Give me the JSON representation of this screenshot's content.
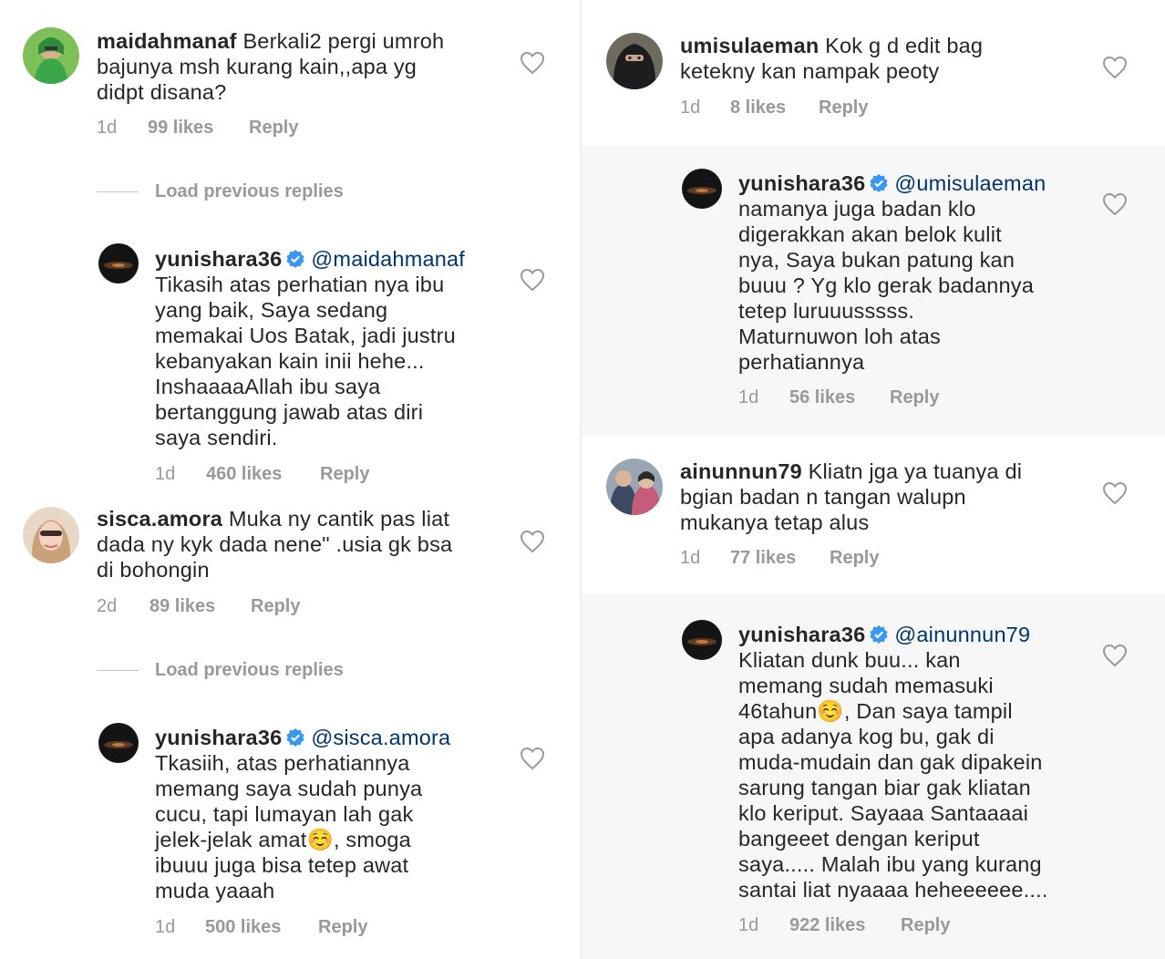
{
  "left": {
    "comments": [
      {
        "username": "maidahmanaf",
        "text": "Berkali2 pergi umroh\nbajunya msh kurang kain,,apa yg\ndidpt disana?",
        "time": "1d",
        "likes": "99 likes",
        "reply": "Reply"
      },
      {
        "username": "yunishara36",
        "mention": "@maidahmanaf",
        "text": "Tikasih atas perhatian nya ibu\nyang baik,  Saya sedang\nmemakai Uos Batak, jadi justru\nkebanyakan kain inii hehe...\nInshaaaaAllah ibu saya\nbertanggung jawab atas diri\nsaya sendiri.",
        "time": "1d",
        "likes": "460 likes",
        "reply": "Reply"
      },
      {
        "username": "sisca.amora",
        "text": "Muka ny cantik pas liat\ndada ny kyk dada nene\" .usia gk bsa\ndi bohongin",
        "time": "2d",
        "likes": "89 likes",
        "reply": "Reply"
      },
      {
        "username": "yunishara36",
        "mention": "@sisca.amora",
        "text_before_emoji": "Tkasiih, atas perhatiannya\nmemang saya sudah punya\ncucu, tapi lumayan lah gak\njelek-jelak amat",
        "emoji": "☺️",
        "text_after_emoji": ", smoga\nibuuu juga bisa tetep awat\nmuda yaaah",
        "time": "1d",
        "likes": "500 likes",
        "reply": "Reply"
      }
    ],
    "load_previous_1": "Load previous replies",
    "load_previous_2": "Load previous replies"
  },
  "right": {
    "comments": [
      {
        "username": "umisulaeman",
        "text": "Kok g d edit bag\nketekny kan nampak peoty",
        "time": "1d",
        "likes": "8 likes",
        "reply": "Reply"
      },
      {
        "username": "yunishara36",
        "mention": "@umisulaeman",
        "text": "namanya juga badan klo\ndigerakkan akan belok kulit\nnya, Saya bukan patung kan\nbuuu ? Yg klo gerak badannya\ntetep luruuusssss.\nMaturnuwon loh atas\nperhatiannya",
        "time": "1d",
        "likes": "56 likes",
        "reply": "Reply"
      },
      {
        "username": "ainunnun79",
        "text": "Kliatn jga ya tuanya di\nbgian badan n tangan walupn\nmukanya tetap alus",
        "time": "1d",
        "likes": "77 likes",
        "reply": "Reply"
      },
      {
        "username": "yunishara36",
        "mention": "@ainunnun79",
        "text_before_emoji": "Kliatan dunk buu... kan\nmemang sudah memasuki\n46tahun",
        "emoji": "☺️",
        "text_after_emoji": ", Dan saya tampil\napa adanya kog bu, gak di\nmuda-mudain dan gak dipakein\nsarung tangan biar gak kliatan\nklo keriput.  Sayaaa Santaaaai\nbangeeet dengan keriput\nsaya..... Malah ibu yang kurang\nsantai liat nyaaaa heheeeeee....",
        "time": "1d",
        "likes": "922 likes",
        "reply": "Reply"
      }
    ]
  },
  "icons": {
    "heart": "heart-outline-icon",
    "verified": "verified-badge-icon"
  },
  "colors": {
    "text": "#262626",
    "meta": "#999999",
    "mention": "#003569",
    "verified": "#3897f0",
    "highlight_bg": "#f7f7f7"
  }
}
